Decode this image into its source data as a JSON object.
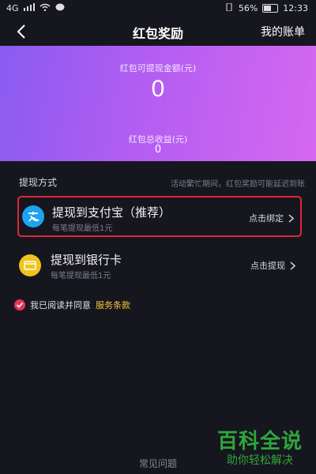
{
  "status_bar": {
    "signal": "4G",
    "battery": "56%",
    "time": "12:33"
  },
  "navbar": {
    "title": "红包奖励",
    "right_link": "我的账单"
  },
  "hero": {
    "withdrawable_label": "红包可提现金额(元)",
    "withdrawable_amount": "0",
    "total_label": "红包总收益(元)",
    "total_amount": "0"
  },
  "withdraw": {
    "heading": "提现方式",
    "note": "活动繁忙期间，红包奖励可能延迟到账",
    "methods": [
      {
        "title": "提现到支付宝（推荐）",
        "subtitle": "每笔提现最低1元",
        "action": "点击绑定",
        "icon": "alipay-icon"
      },
      {
        "title": "提现到银行卡",
        "subtitle": "每笔提现最低1元",
        "action": "点击提现",
        "icon": "bank-card-icon"
      }
    ]
  },
  "agreement": {
    "text": "我已阅读并同意",
    "link": "服务条款"
  },
  "footer": {
    "faq": "常见问题"
  },
  "watermark": {
    "main": "百科全说",
    "sub": "助你轻松解决"
  },
  "colors": {
    "background": "#16161e",
    "hero_gradient_start": "#8a5cf0",
    "hero_gradient_end": "#d568f0",
    "highlight_border": "#e0253a",
    "link": "#f6c43d",
    "alipay": "#1da3f0",
    "bank": "#f0c41d"
  }
}
